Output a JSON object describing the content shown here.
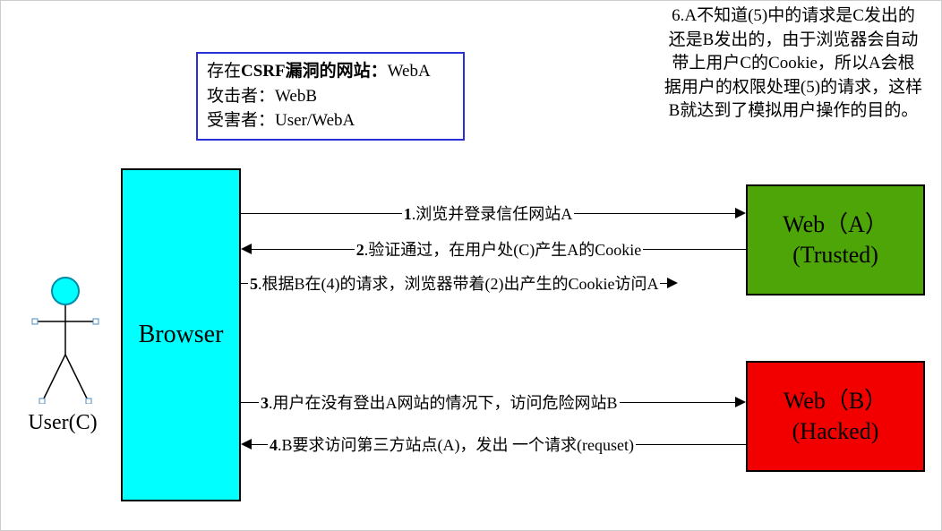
{
  "legend": {
    "line1_prefix": "存在",
    "line1_bold": "CSRF漏洞的网站：",
    "line1_rest": "WebA",
    "line2": "攻击者：WebB",
    "line3": "受害者：User/WebA"
  },
  "note6": "6.A不知道(5)中的请求是C发出的还是B发出的，由于浏览器会自动带上用户C的Cookie，所以A会根据用户的权限处理(5)的请求，这样B就达到了模拟用户操作的目的。",
  "user_label": "User(C)",
  "browser_label": "Browser",
  "webA_line1": "Web（A）",
  "webA_line2": "(Trusted)",
  "webB_line1": "Web（B）",
  "webB_line2": "(Hacked)",
  "steps": {
    "s1_num": "1",
    "s1_txt": ".浏览并登录信任网站A",
    "s2_num": "2",
    "s2_txt": ".验证通过，在用户处(C)产生A的Cookie",
    "s3_num": "3",
    "s3_txt": ".用户在没有登出A网站的情况下，访问危险网站B",
    "s4_num": "4",
    "s4_txt": ".B要求访问第三方站点(A)，发出 一个请求(requset)",
    "s5_num": "5",
    "s5_txt": ".根据B在(4)的请求，浏览器带着(2)出产生的Cookie访问A"
  }
}
